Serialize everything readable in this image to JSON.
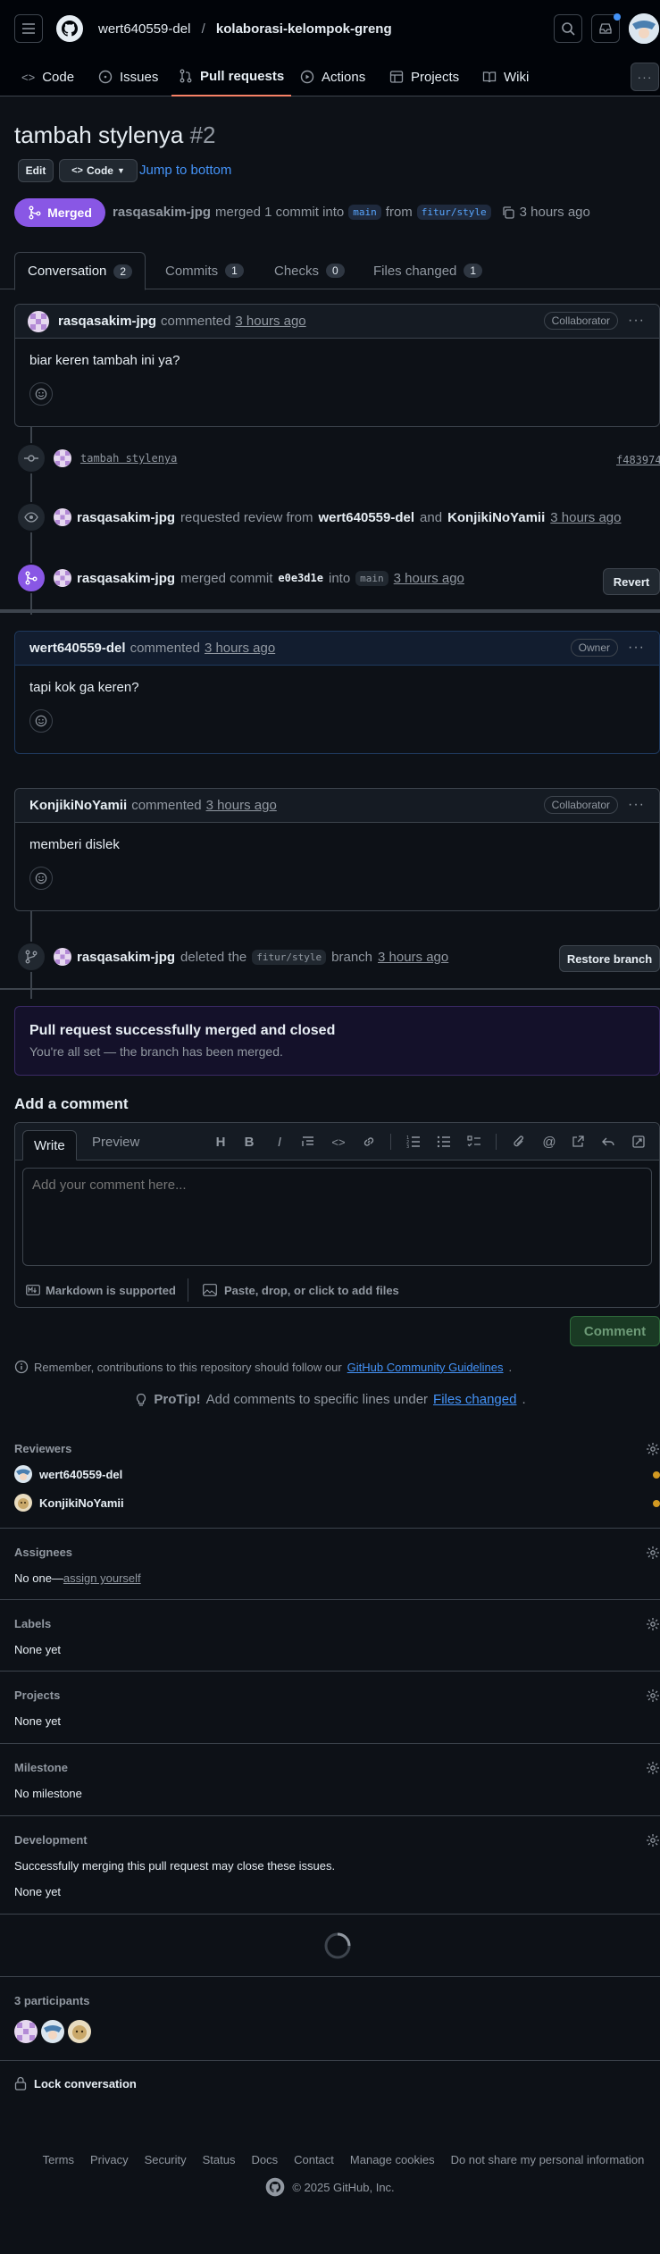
{
  "header": {
    "owner": "wert640559-del",
    "separator": "/",
    "repo": "kolaborasi-kelompok-greng"
  },
  "nav": {
    "code": "Code",
    "issues": "Issues",
    "pull_requests": "Pull requests",
    "actions": "Actions",
    "projects": "Projects",
    "wiki": "Wiki"
  },
  "pr": {
    "title": "tambah stylenya",
    "number": "#2",
    "edit_label": "Edit",
    "code_label": "Code",
    "jump_label": "Jump to bottom",
    "state": "Merged",
    "merger": "rasqasakim-jpg",
    "merged_text": "merged 1 commit into",
    "base_branch": "main",
    "from_text": "from",
    "head_branch": "fitur/style",
    "time": "3 hours ago"
  },
  "tabs": {
    "conversation": "Conversation",
    "conversation_count": "2",
    "commits": "Commits",
    "commits_count": "1",
    "checks": "Checks",
    "checks_count": "0",
    "files": "Files changed",
    "files_count": "1"
  },
  "first_comment": {
    "author": "rasqasakim-jpg",
    "action": "commented",
    "time": "3 hours ago",
    "role": "Collaborator",
    "body": "biar keren tambah ini ya?"
  },
  "timeline": {
    "commit_msg": "tambah stylenya",
    "commit_sha": "f483974",
    "review_user": "rasqasakim-jpg",
    "review_text": "requested review from",
    "reviewer1": "wert640559-del",
    "and_text": "and",
    "reviewer2": "KonjikiNoYamii",
    "review_time": "3 hours ago",
    "merge_user": "rasqasakim-jpg",
    "merge_text": "merged commit",
    "merge_sha": "e0e3d1e",
    "into_text": "into",
    "merge_branch": "main",
    "merge_time": "3 hours ago",
    "revert_label": "Revert",
    "delete_user": "rasqasakim-jpg",
    "delete_text": "deleted the",
    "delete_branch": "fitur/style",
    "branch_text": "branch",
    "delete_time": "3 hours ago",
    "restore_label": "Restore branch"
  },
  "comment2": {
    "author": "wert640559-del",
    "action": "commented",
    "time": "3 hours ago",
    "role": "Owner",
    "body": "tapi kok ga keren?"
  },
  "comment3": {
    "author": "KonjikiNoYamii",
    "action": "commented",
    "time": "3 hours ago",
    "role": "Collaborator",
    "body": "memberi dislek"
  },
  "merged_box": {
    "title": "Pull request successfully merged and closed",
    "subtitle": "You're all set — the branch has been merged."
  },
  "add_comment": {
    "heading": "Add a comment",
    "write_tab": "Write",
    "preview_tab": "Preview",
    "placeholder": "Add your comment here...",
    "markdown_note": "Markdown is supported",
    "attach_note": "Paste, drop, or click to add files",
    "submit": "Comment",
    "guidelines_prefix": "Remember, contributions to this repository should follow our",
    "guidelines_link": "GitHub Community Guidelines",
    "protip_label": "ProTip!",
    "protip_text": "Add comments to specific lines under",
    "protip_link": "Files changed"
  },
  "sidebar": {
    "reviewers_label": "Reviewers",
    "reviewer1": "wert640559-del",
    "reviewer2": "KonjikiNoYamii",
    "assignees_label": "Assignees",
    "assignees_none": "No one—",
    "assign_yourself": "assign yourself",
    "labels_label": "Labels",
    "labels_value": "None yet",
    "projects_label": "Projects",
    "projects_value": "None yet",
    "milestone_label": "Milestone",
    "milestone_value": "No milestone",
    "development_label": "Development",
    "development_note": "Successfully merging this pull request may close these issues.",
    "development_value": "None yet",
    "participants_label": "3 participants",
    "lock_label": "Lock conversation"
  },
  "footer": {
    "links": [
      "Terms",
      "Privacy",
      "Security",
      "Status",
      "Docs",
      "Contact",
      "Manage cookies",
      "Do not share my personal information"
    ],
    "copyright": "© 2025 GitHub, Inc."
  },
  "colors": {
    "merged_purple": "#8957e5",
    "accent_blue": "#4493f8",
    "active_tab_underline": "#f78166",
    "comment_green": "#238636"
  }
}
